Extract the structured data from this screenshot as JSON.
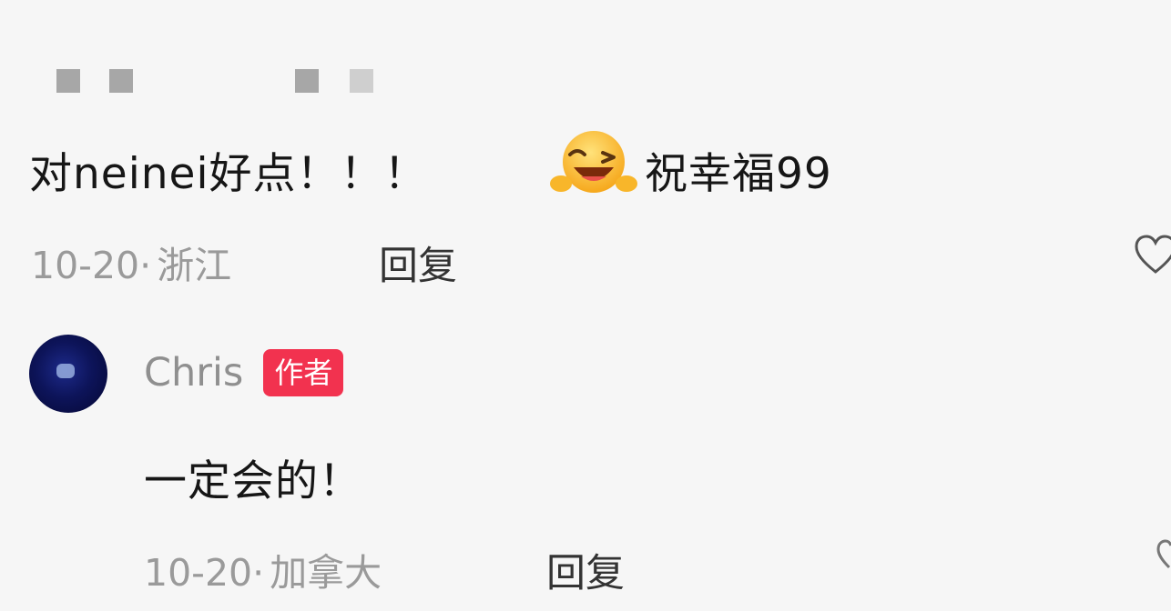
{
  "comment1": {
    "text_before_emoji": "对neinei好点！！！",
    "emoji": "wink-laugh-emoji",
    "text_after_emoji": "祝幸福99",
    "date": "10-20",
    "location": "浙江",
    "reply_label": "回复"
  },
  "comment2": {
    "username": "Chris",
    "badge": "作者",
    "text": "一定会的！",
    "date": "10-20",
    "location": "加拿大",
    "reply_label": "回复"
  },
  "separator": "·"
}
